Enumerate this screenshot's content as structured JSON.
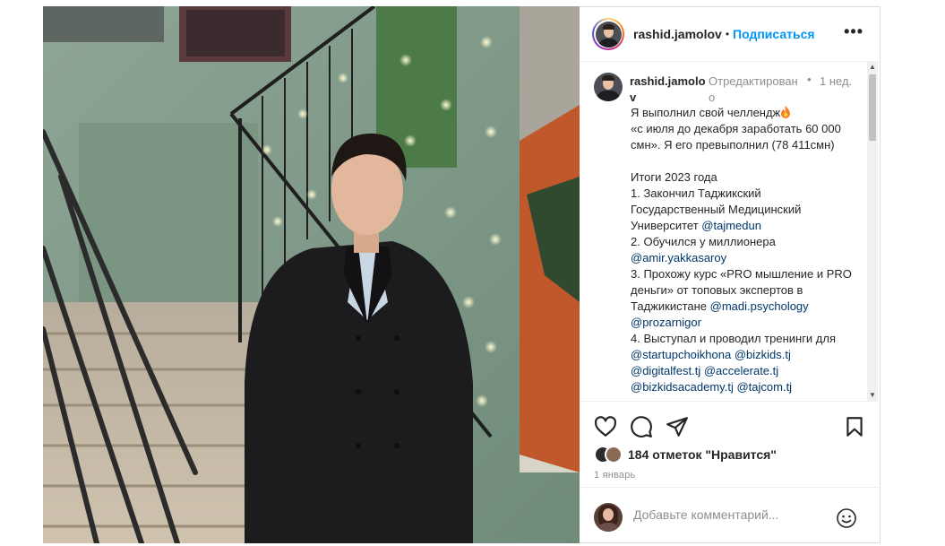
{
  "post": {
    "author": "rashid.jamolov",
    "follow_label": "Подписаться",
    "separator": "•",
    "more_label": "•••"
  },
  "caption": {
    "username": "rashid.jamolov",
    "edited": "Отредактировано",
    "dot": "•",
    "time": "1 нед.",
    "lines": {
      "l1": "Я выполнил свой челлендж",
      "l2": "«с июля до декабря заработать 60 000 смн». Я его превыполнил (78 411смн)",
      "l3": "Итоги 2023 года",
      "l4": "1. Закончил Таджикский Государственный Медицинский Университет ",
      "l4m": "@tajmedun",
      "l5": "2. Обучился у миллионера",
      "l5m": "@amir.yakkasaroy",
      "l6": "3. Прохожу курс «PRO мышление и PRO деньги» от топовых экспертов в Таджикистане ",
      "l6m1": "@madi.psychology",
      "l6m2": "@prozarnigor",
      "l7": "4. Выступал и проводил тренинги для",
      "l7m1": "@startupchoikhona",
      "l7m2": "@bizkids.tj",
      "l7m3": "@digitalfest.tj",
      "l7m4": "@accelerate.tj",
      "l7m5": "@bizkidsacademy.tj",
      "l7m6": "@tajcom.tj"
    }
  },
  "stats": {
    "likes": "184 отметок \"Нравится\"",
    "date": "1 январь"
  },
  "comment_box": {
    "placeholder": "Добавьте комментарий..."
  },
  "icons": {
    "like": "heart-icon",
    "comment": "comment-icon",
    "share": "paper-plane-icon",
    "save": "bookmark-icon",
    "emoji": "smiley-icon",
    "more": "more-dots-icon"
  },
  "colors": {
    "accent": "#0095f6",
    "mention": "#00376b",
    "muted": "#8e8e8e",
    "wall": "#7e9a86"
  }
}
